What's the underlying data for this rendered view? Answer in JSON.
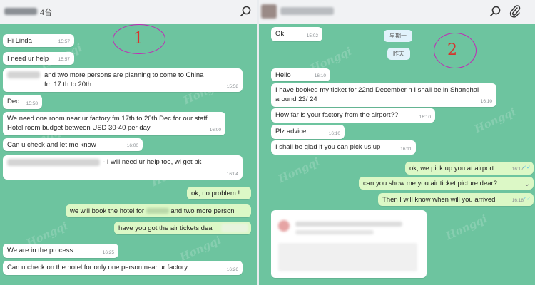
{
  "watermark": "Hongqi",
  "left": {
    "header_title": "4台",
    "annotation_number": "1",
    "messages": [
      {
        "text": "Hi Linda",
        "time": "15:57"
      },
      {
        "text": "I need ur help",
        "time": "15:57"
      },
      {
        "text": "and two more persons are planning to come to China fm 17 th to 20th",
        "time": "15:58"
      },
      {
        "text": "Dec",
        "time": "15:58"
      },
      {
        "text": "We need one room near ur factory fm 17th to 20th Dec for our staff Hotel room budget between USD 30-40 per day",
        "time": "16:00"
      },
      {
        "text": "Can u check and let me know",
        "time": "16:00"
      },
      {
        "text": "- I will need ur help too, wl get bk",
        "time": "16:04"
      },
      {
        "text": "ok, no problem !",
        "time": ""
      },
      {
        "text": "we will book the hotel for",
        "text2": "and two more person",
        "time": ""
      },
      {
        "text": "have you got the air tickets dea",
        "time": ""
      },
      {
        "text": "We are in the process",
        "time": "16:25"
      },
      {
        "text": "Can u check on the hotel for only one person near ur factory",
        "time": "16:26"
      }
    ]
  },
  "right": {
    "annotation_number": "2",
    "date_pills": [
      "星期一",
      "昨天"
    ],
    "messages": [
      {
        "text": "Ok",
        "time": "15:02"
      },
      {
        "text": "Hello",
        "time": "16:10"
      },
      {
        "text": "I have booked my ticket for 22nd December n I shall be in Shanghai around 23/ 24",
        "time": "16:10"
      },
      {
        "text": "How far is your factory from the airport??",
        "time": "16:10"
      },
      {
        "text": "Plz advice",
        "time": "16:10"
      },
      {
        "text": "I shall be glad if you can pick us up",
        "time": "16:11"
      },
      {
        "text": "ok, we pick up you at airport",
        "time": "16:17"
      },
      {
        "text": "can you show me you air ticket picture dear?",
        "time": ""
      },
      {
        "text": "Then I will know when will you arrived",
        "time": "16:18"
      }
    ]
  },
  "colors": {
    "chat_bg": "#6dc49f",
    "incoming": "#ffffff",
    "outgoing": "#dcf8c6",
    "annotation_circle": "#c02bb6",
    "annotation_number": "#d6342c"
  },
  "icons": [
    "search-icon",
    "attach-icon",
    "read-ticks-icon",
    "chevron-down-icon"
  ]
}
